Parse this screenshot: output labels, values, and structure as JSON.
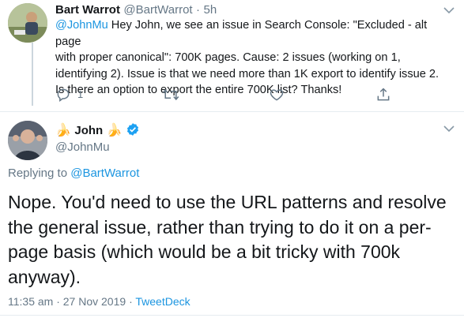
{
  "tweet1": {
    "author_name": "Bart Warrot",
    "handle": "@BartWarrot",
    "separator": "·",
    "time": "5h",
    "mention": "@JohnMu",
    "text_lines": [
      " Hey John, we see an issue in Search Console: \"Excluded - alt page",
      "with proper canonical\": 700K pages. Cause: 2 issues (working on 1,",
      "identifying 2). Issue is that we need more than 1K export to identify issue 2.",
      "Is there an option to export the entire 700K list? Thanks!"
    ],
    "reply_count": "1",
    "icons": [
      "reply-icon",
      "retweet-icon",
      "like-icon",
      "share-icon",
      "chevron-down-icon"
    ]
  },
  "tweet2": {
    "author_name": "John",
    "emoji": "🍌",
    "handle": "@JohnMu",
    "verified_icon": "verified-badge-icon",
    "replying_to_label": "Replying to",
    "replying_to_handle": "@BartWarrot",
    "text_lines": [
      "Nope. You'd need to use the URL patterns and resolve",
      "the general issue, rather than trying to do it on a per-",
      "page basis (which would be a bit tricky with 700k",
      "anyway)."
    ],
    "timestamp": "11:35 am · 27 Nov 2019",
    "separator": "·",
    "source": "TweetDeck"
  },
  "colors": {
    "accent": "#1da1f2",
    "link": "#1b95e0",
    "muted": "#657786",
    "divider": "#e6ecf0"
  }
}
